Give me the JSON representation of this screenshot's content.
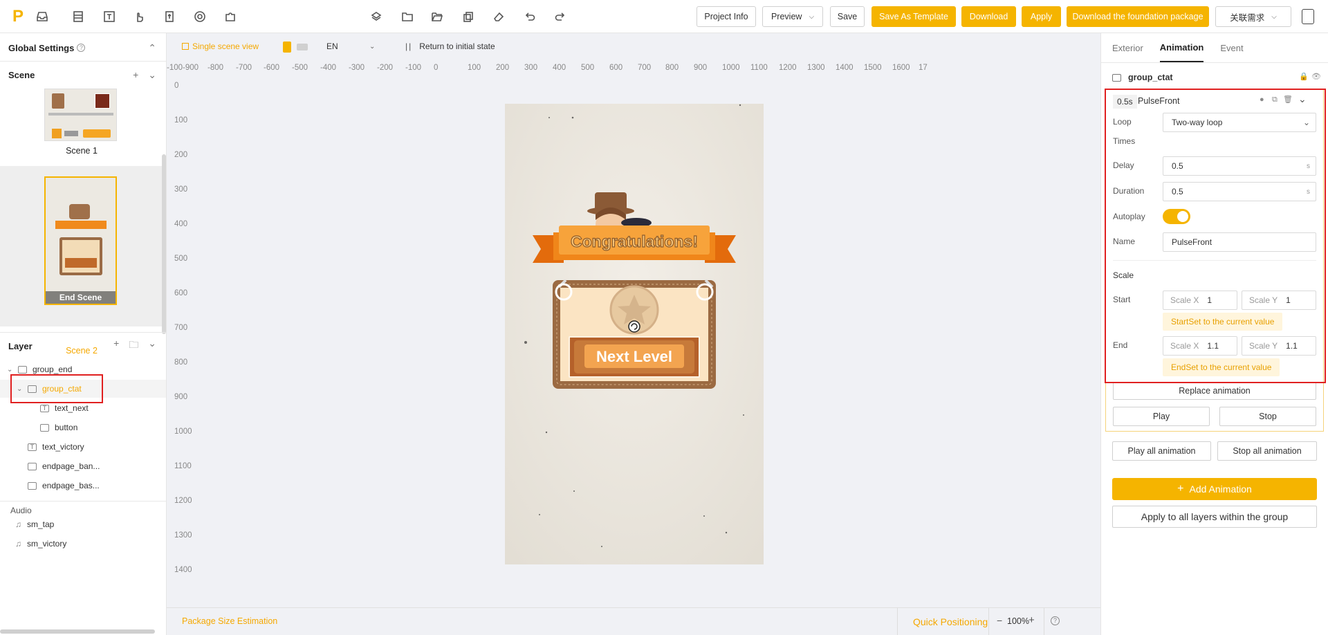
{
  "toolbar": {
    "logo": "P",
    "buttons": {
      "project_info": "Project Info",
      "preview": "Preview",
      "save": "Save",
      "save_as_template": "Save As Template",
      "download": "Download",
      "apply": "Apply",
      "download_foundation": "Download the foundation package",
      "related_needs": "关联需求"
    }
  },
  "left": {
    "global_settings": "Global Settings",
    "scene_title": "Scene",
    "scenes": [
      {
        "label": "Scene 1"
      },
      {
        "label": "Scene 2",
        "overlay": "End Scene"
      }
    ],
    "layer_title": "Layer",
    "layers": [
      {
        "label": "group_end"
      },
      {
        "label": "group_ctat"
      },
      {
        "label": "text_next"
      },
      {
        "label": "button"
      },
      {
        "label": "text_victory"
      },
      {
        "label": "endpage_ban..."
      },
      {
        "label": "endpage_bas..."
      }
    ],
    "audio_title": "Audio",
    "audio": [
      {
        "label": "sm_tap"
      },
      {
        "label": "sm_victory"
      }
    ]
  },
  "canvas": {
    "single_scene_view": "Single scene view",
    "language": "EN",
    "return_initial": "Return to initial state",
    "ruler_x": [
      "-100",
      "-900",
      "-800",
      "-700",
      "-600",
      "-500",
      "-400",
      "-300",
      "-200",
      "-100",
      "0",
      "100",
      "200",
      "300",
      "400",
      "500",
      "600",
      "700",
      "800",
      "900",
      "1000",
      "1100",
      "1200",
      "1300",
      "1400",
      "1500",
      "1600",
      "17"
    ],
    "ruler_y": [
      "0",
      "100",
      "200",
      "300",
      "400",
      "500",
      "600",
      "700",
      "800",
      "900",
      "1000",
      "1100",
      "1200",
      "1300",
      "1400"
    ],
    "banner_text": "Congratulations!",
    "next_level_text": "Next Level"
  },
  "bottom": {
    "package_size": "Package Size Estimation",
    "quick_positioning": "Quick Positioning",
    "zoom_minus": "−",
    "zoom": "100%",
    "zoom_plus": "+"
  },
  "right": {
    "tabs": [
      "Exterior",
      "Animation",
      "Event"
    ],
    "group_name": "group_ctat",
    "anim": {
      "duration_badge": "0.5s",
      "name": "PulseFront",
      "loop_label": "Loop",
      "loop_value": "Two-way loop",
      "times_label": "Times",
      "delay_label": "Delay",
      "delay_value": "0.5",
      "duration_label": "Duration",
      "duration_value": "0.5",
      "unit": "s",
      "autoplay_label": "Autoplay",
      "autoplay_on": true,
      "name_label": "Name",
      "name_value": "PulseFront",
      "scale_title": "Scale",
      "start_label": "Start",
      "end_label": "End",
      "scale_x_label": "Scale X",
      "scale_y_label": "Scale Y",
      "start_x": "1",
      "start_y": "1",
      "end_x": "1.1",
      "end_y": "1.1",
      "start_set_btn": "StartSet to the current value",
      "end_set_btn": "EndSet to the current value"
    },
    "replace_animation": "Replace animation",
    "play": "Play",
    "stop": "Stop",
    "play_all": "Play all animation",
    "stop_all": "Stop all animation",
    "add_animation": "Add Animation",
    "apply_all_layers": "Apply to all layers within the group"
  },
  "colors": {
    "accent": "#f5b400",
    "highlight_red": "#e02020",
    "banner_orange": "#f08a1c"
  }
}
